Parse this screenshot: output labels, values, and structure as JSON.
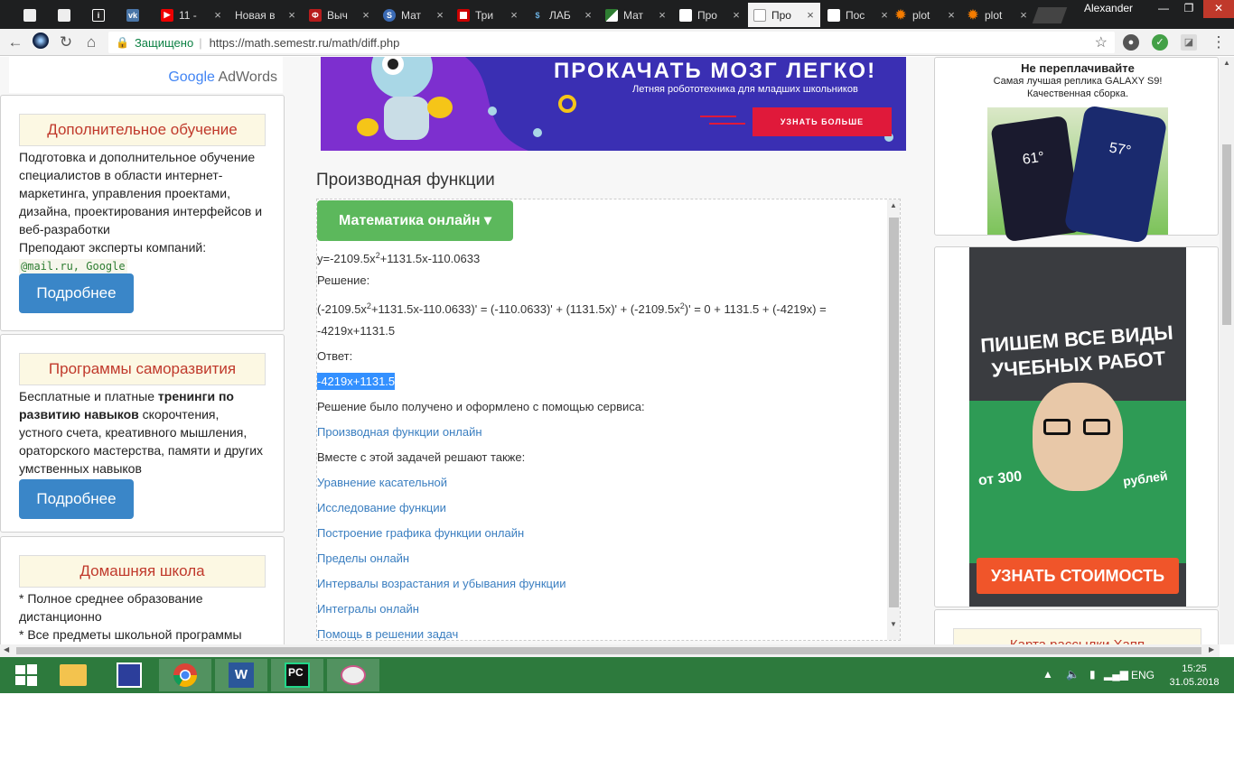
{
  "browser": {
    "tabs": [
      {
        "title": "",
        "icon": "document-icon"
      },
      {
        "title": "",
        "icon": "document-icon"
      },
      {
        "title": "",
        "icon": "info-icon"
      },
      {
        "title": "",
        "icon": "vk-icon"
      },
      {
        "title": "11 -",
        "icon": "youtube-icon"
      },
      {
        "title": "Новая в",
        "icon": "none"
      },
      {
        "title": "Выч",
        "icon": "university-icon"
      },
      {
        "title": "Мат",
        "icon": "globe-icon"
      },
      {
        "title": "Три",
        "icon": "flag-icon"
      },
      {
        "title": "ЛАБ",
        "icon": "dollar-icon"
      },
      {
        "title": "Мат",
        "icon": "map-icon"
      },
      {
        "title": "Про",
        "icon": "page-icon"
      },
      {
        "title": "Про",
        "icon": "page-icon"
      },
      {
        "title": "Пос",
        "icon": "page-icon"
      },
      {
        "title": "plot",
        "icon": "gear-icon"
      },
      {
        "title": "plot",
        "icon": "gear-icon"
      }
    ],
    "user": "Alexander",
    "secure_label": "Защищено",
    "url": "https://math.semestr.ru/math/diff.php"
  },
  "left": {
    "adwords": {
      "google": "Google",
      "adwords": "AdWords"
    },
    "box1": {
      "title": "Дополнительное обучение",
      "text": "Подготовка и дополнительное обучение специалистов в области интернет-маркетинга, управления проектами, дизайна, проектирования интерфейсов и веб-разработки",
      "text2": "Преподают эксперты компаний:",
      "code": "@mail.ru, Google",
      "button": "Подробнее"
    },
    "box2": {
      "title": "Программы саморазвития",
      "text_a": "Бесплатные и платные ",
      "text_b": "тренинги по развитию навыков",
      "text_c": " скорочтения, устного счета, креативного мышления, ораторского мастерства, памяти и других умственных навыков",
      "button": "Подробнее"
    },
    "box3": {
      "title": "Домашняя школа",
      "line1": "* Полное среднее образование дистанционно",
      "line2": "* Все предметы школьной программы"
    }
  },
  "banner": {
    "title": "ПРОКАЧАТЬ МОЗГ ЛЕГКО!",
    "subtitle": "Летняя робототехника для младших школьников",
    "button": "УЗНАТЬ БОЛЬШЕ"
  },
  "main": {
    "title": "Производная функции",
    "menu_button": "Математика онлайн ▾",
    "func_a": "y=-2109.5x",
    "func_sup": "2",
    "func_b": "+1131.5x-110.0633",
    "solution_label": "Решение:",
    "solution_a": "(-2109.5x",
    "solution_sup1": "2",
    "solution_b": "+1131.5x-110.0633)' = (-110.0633)' + (1131.5x)' + (-2109.5x",
    "solution_sup2": "2",
    "solution_c": ")' = 0 + 1131.5 + (-4219x) =",
    "solution_result": "-4219x+1131.5",
    "answer_label": "Ответ:",
    "answer": "-4219x+1131.5",
    "service_text": "Решение было получено и оформлено с помощью сервиса:",
    "service_link": "Производная функции онлайн",
    "also_text": "Вместе с этой задачей решают также:",
    "links": [
      "Уравнение касательной",
      "Исследование функции",
      "Построение графика функции онлайн",
      "Пределы онлайн",
      "Интервалы возрастания и убывания функции",
      "Интегралы онлайн",
      "Помощь в решении задач"
    ]
  },
  "right": {
    "ad1": {
      "title": "Не переплачивайте",
      "line1": "Самая лучшая реплика GALAXY S9!",
      "line2": "Качественная сборка.",
      "phone_time1": "61°",
      "phone_time2": "57°"
    },
    "ad2": {
      "headline": "ПИШЕМ ВСЕ ВИДЫ УЧЕБНЫХ РАБОТ",
      "from": "от 300",
      "rub": "рублей",
      "button": "УЗНАТЬ СТОИМОСТЬ"
    },
    "ad3": {
      "title": "Карта рассылки Хапп"
    }
  },
  "taskbar": {
    "lang": "ENG",
    "time": "15:25",
    "date": "31.05.2018"
  }
}
